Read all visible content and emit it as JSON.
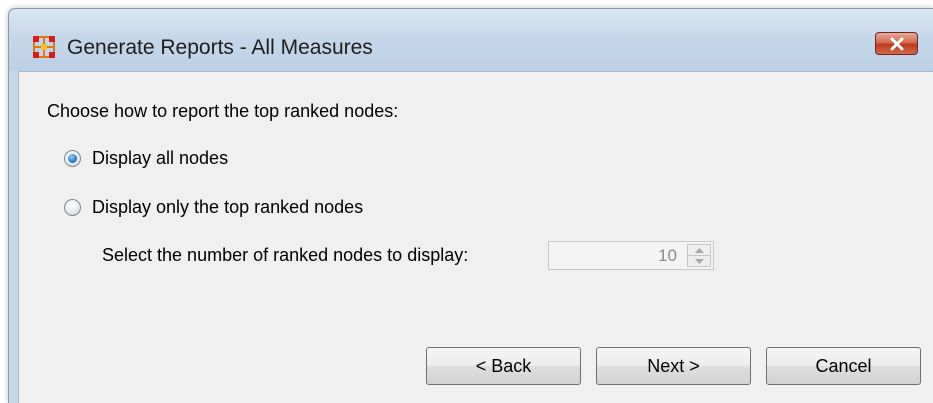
{
  "window": {
    "title": "Generate Reports - All Measures",
    "close_icon": "close-x-icon",
    "app_icon": "network-nodes-icon"
  },
  "dialog": {
    "prompt": "Choose how to report the top ranked nodes:",
    "options": [
      {
        "label": "Display all nodes",
        "selected": true
      },
      {
        "label": "Display only the top ranked nodes",
        "selected": false
      }
    ],
    "spinner": {
      "label": "Select the number of ranked nodes to display:",
      "value": "10",
      "enabled": false
    }
  },
  "buttons": {
    "back": "< Back",
    "next": "Next >",
    "cancel": "Cancel"
  },
  "colors": {
    "title_bar": "#c4d6ea",
    "close_button": "#c0391e",
    "radio_selected": "#2a7fc9",
    "content_bg": "#f0f0f0"
  }
}
